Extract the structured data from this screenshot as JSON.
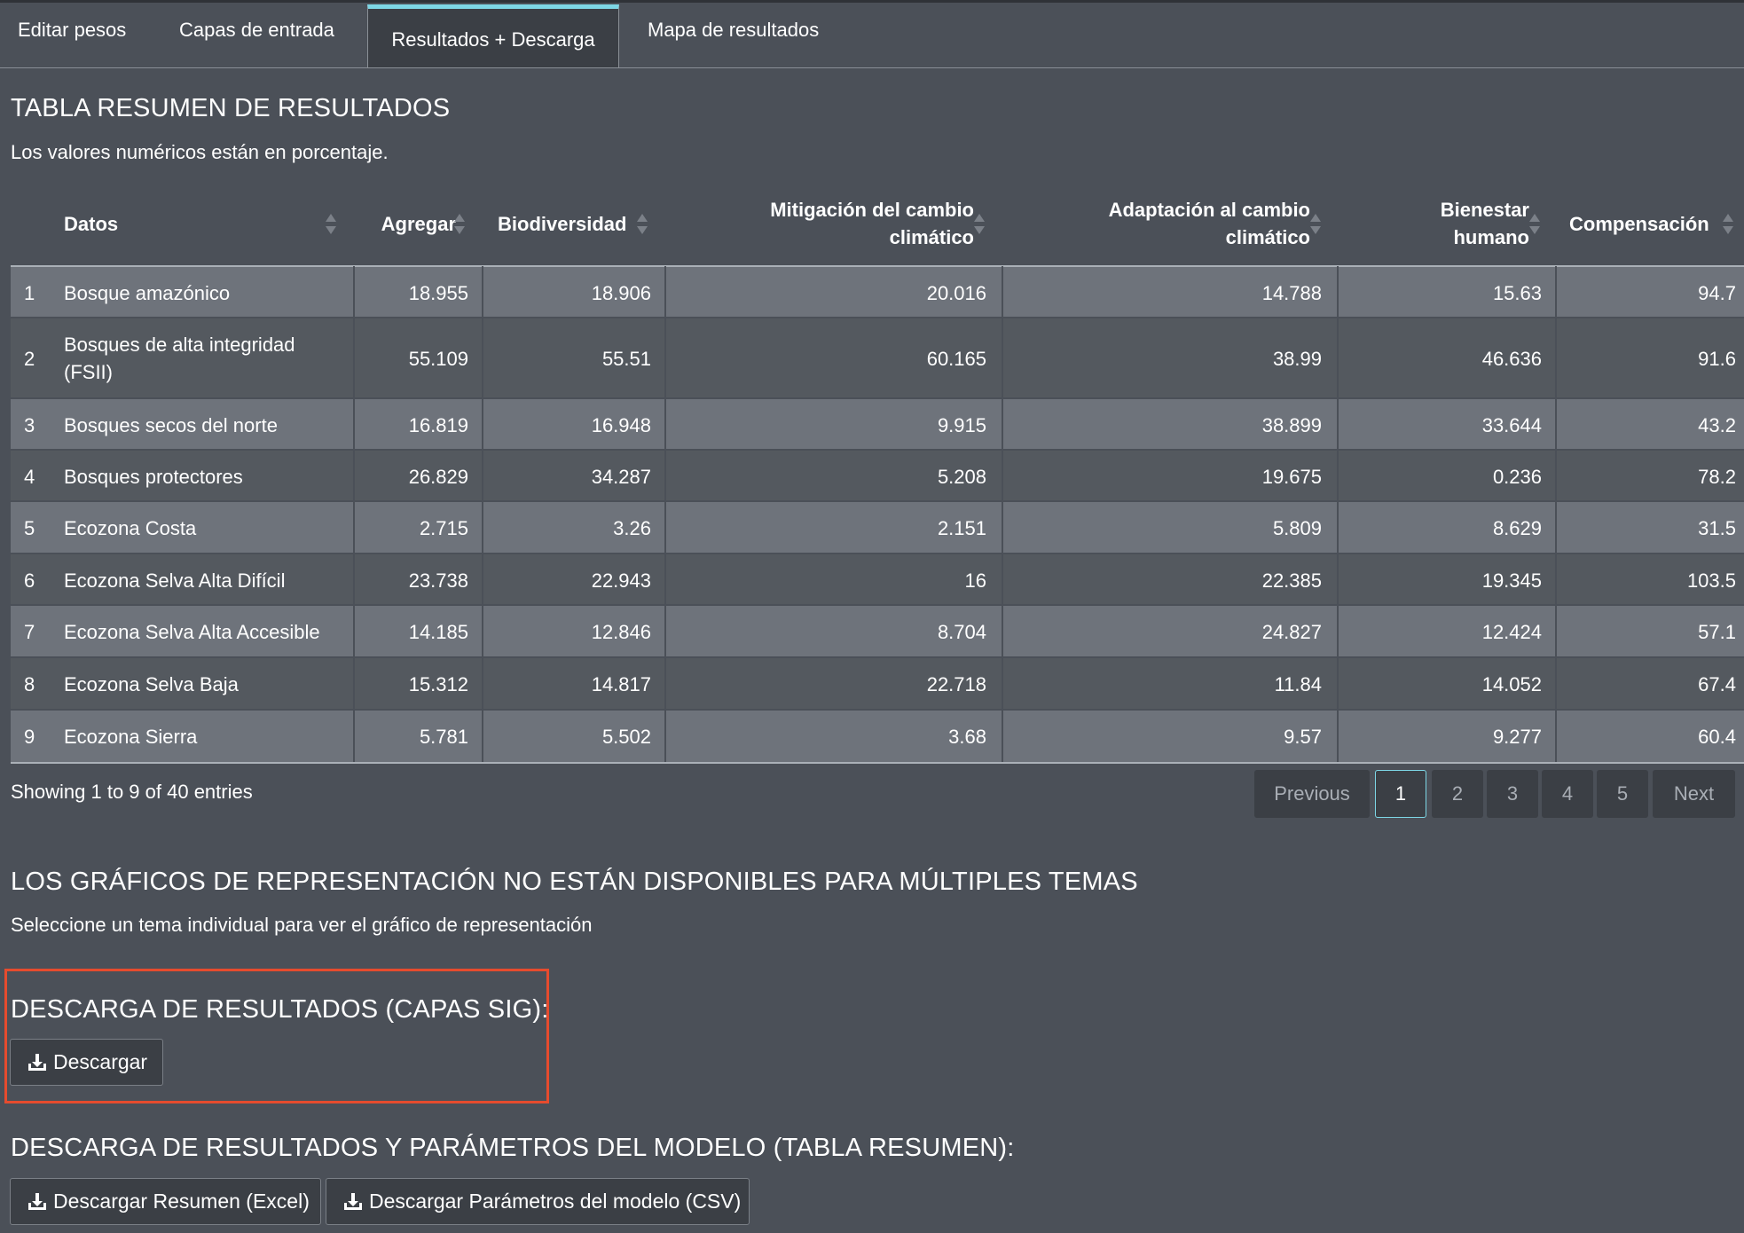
{
  "tabs": [
    "Editar pesos",
    "Capas de entrada",
    "Resultados + Descarga",
    "Mapa de resultados"
  ],
  "summary": {
    "title": "TABLA RESUMEN DE RESULTADOS",
    "note": "Los valores numéricos están en porcentaje."
  },
  "table": {
    "headers": {
      "datos": "Datos",
      "agregar": "Agregar",
      "biodiversidad": "Biodiversidad",
      "mitigacion_l1": "Mitigación del cambio",
      "mitigacion_l2": "climático",
      "adaptacion_l1": "Adaptación al cambio",
      "adaptacion_l2": "climático",
      "bienestar_l1": "Bienestar",
      "bienestar_l2": "humano",
      "compensacion": "Compensación"
    },
    "rows": [
      {
        "n": "1",
        "datos": "Bosque amazónico",
        "datos2": "",
        "agregar": "18.955",
        "bio": "18.906",
        "mit": "20.016",
        "ada": "14.788",
        "bie": "15.63",
        "com": "94.7"
      },
      {
        "n": "2",
        "datos": "Bosques de alta integridad",
        "datos2": "(FSII)",
        "agregar": "55.109",
        "bio": "55.51",
        "mit": "60.165",
        "ada": "38.99",
        "bie": "46.636",
        "com": "91.6"
      },
      {
        "n": "3",
        "datos": "Bosques secos del norte",
        "datos2": "",
        "agregar": "16.819",
        "bio": "16.948",
        "mit": "9.915",
        "ada": "38.899",
        "bie": "33.644",
        "com": "43.2"
      },
      {
        "n": "4",
        "datos": "Bosques protectores",
        "datos2": "",
        "agregar": "26.829",
        "bio": "34.287",
        "mit": "5.208",
        "ada": "19.675",
        "bie": "0.236",
        "com": "78.2"
      },
      {
        "n": "5",
        "datos": "Ecozona Costa",
        "datos2": "",
        "agregar": "2.715",
        "bio": "3.26",
        "mit": "2.151",
        "ada": "5.809",
        "bie": "8.629",
        "com": "31.5"
      },
      {
        "n": "6",
        "datos": "Ecozona Selva Alta Difícil",
        "datos2": "",
        "agregar": "23.738",
        "bio": "22.943",
        "mit": "16",
        "ada": "22.385",
        "bie": "19.345",
        "com": "103.5"
      },
      {
        "n": "7",
        "datos": "Ecozona Selva Alta Accesible",
        "datos2": "",
        "agregar": "14.185",
        "bio": "12.846",
        "mit": "8.704",
        "ada": "24.827",
        "bie": "12.424",
        "com": "57.1"
      },
      {
        "n": "8",
        "datos": "Ecozona Selva Baja",
        "datos2": "",
        "agregar": "15.312",
        "bio": "14.817",
        "mit": "22.718",
        "ada": "11.84",
        "bie": "14.052",
        "com": "67.4"
      },
      {
        "n": "9",
        "datos": "Ecozona Sierra",
        "datos2": "",
        "agregar": "5.781",
        "bio": "5.502",
        "mit": "3.68",
        "ada": "9.57",
        "bie": "9.277",
        "com": "60.4"
      }
    ],
    "info": "Showing 1 to 9 of 40 entries"
  },
  "pagination": {
    "previous": "Previous",
    "pages": [
      "1",
      "2",
      "3",
      "4",
      "5"
    ],
    "next": "Next",
    "current": "1"
  },
  "graphs": {
    "title": "LOS GRÁFICOS DE REPRESENTACIÓN NO ESTÁN DISPONIBLES PARA MÚLTIPLES TEMAS",
    "note": "Seleccione un tema individual para ver el gráfico de representación"
  },
  "download_gis": {
    "title": "DESCARGA DE RESULTADOS (CAPAS SIG):",
    "button": "Descargar"
  },
  "download_table": {
    "title": "DESCARGA DE RESULTADOS Y PARÁMETROS DEL MODELO (TABLA RESUMEN):",
    "excel_button": "Descargar Resumen (Excel)",
    "csv_button": "Descargar Parámetros del modelo (CSV)"
  },
  "colors": {
    "background": "#4b5058",
    "row_odd": "#6e737b",
    "row_even": "#54595f",
    "active_tab_accent": "#7dd6e5",
    "highlight_box": "#e64b2e"
  }
}
